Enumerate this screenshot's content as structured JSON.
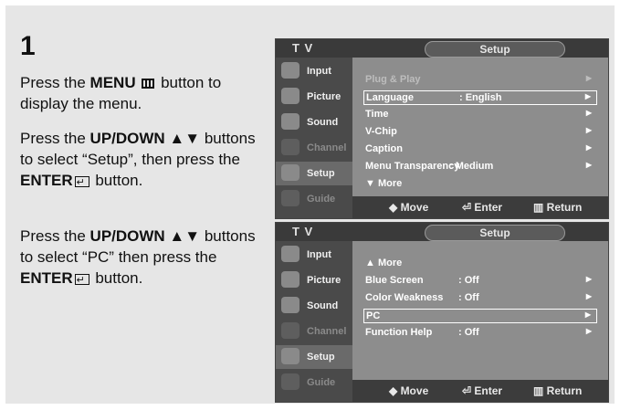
{
  "step": "1",
  "instructions": {
    "p1": {
      "a": "Press the ",
      "b": "MENU",
      "c": " button to display the menu."
    },
    "p2": {
      "a": "Press the ",
      "b": "UP/DOWN ▲▼",
      "c": " buttons to select “Setup”, then press the ",
      "d": "ENTER",
      "e": " button."
    },
    "p3": {
      "a": "Press the ",
      "b": "UP/DOWN ▲▼",
      "c": " buttons to select “PC” then press the ",
      "d": "ENTER",
      "e": " button."
    }
  },
  "osd_common": {
    "tv_label": "T V",
    "title": "Setup",
    "sidebar": [
      "Input",
      "Picture",
      "Sound",
      "Channel",
      "Setup",
      "Guide"
    ],
    "footer": {
      "move": "◆ Move",
      "enter": "Enter",
      "return": "Return"
    }
  },
  "screen1": {
    "rows": [
      {
        "name": "Plug & Play",
        "value": "",
        "arrow": "▶"
      },
      {
        "name": "Language",
        "value": ": English",
        "arrow": "▶"
      },
      {
        "name": "Time",
        "value": "",
        "arrow": "▶"
      },
      {
        "name": "V-Chip",
        "value": "",
        "arrow": "▶"
      },
      {
        "name": "Caption",
        "value": "",
        "arrow": "▶"
      },
      {
        "name": "Menu Transparency",
        "value": ": Medium",
        "arrow": "▶"
      },
      {
        "name": "▼ More",
        "value": "",
        "arrow": ""
      }
    ]
  },
  "screen2": {
    "rows": [
      {
        "name": "▲ More",
        "value": "",
        "arrow": ""
      },
      {
        "name": "Blue Screen",
        "value": ": Off",
        "arrow": "▶"
      },
      {
        "name": "Color Weakness",
        "value": ": Off",
        "arrow": "▶"
      },
      {
        "name": "PC",
        "value": "",
        "arrow": "▶"
      },
      {
        "name": "Function Help",
        "value": ": Off",
        "arrow": "▶"
      }
    ]
  }
}
